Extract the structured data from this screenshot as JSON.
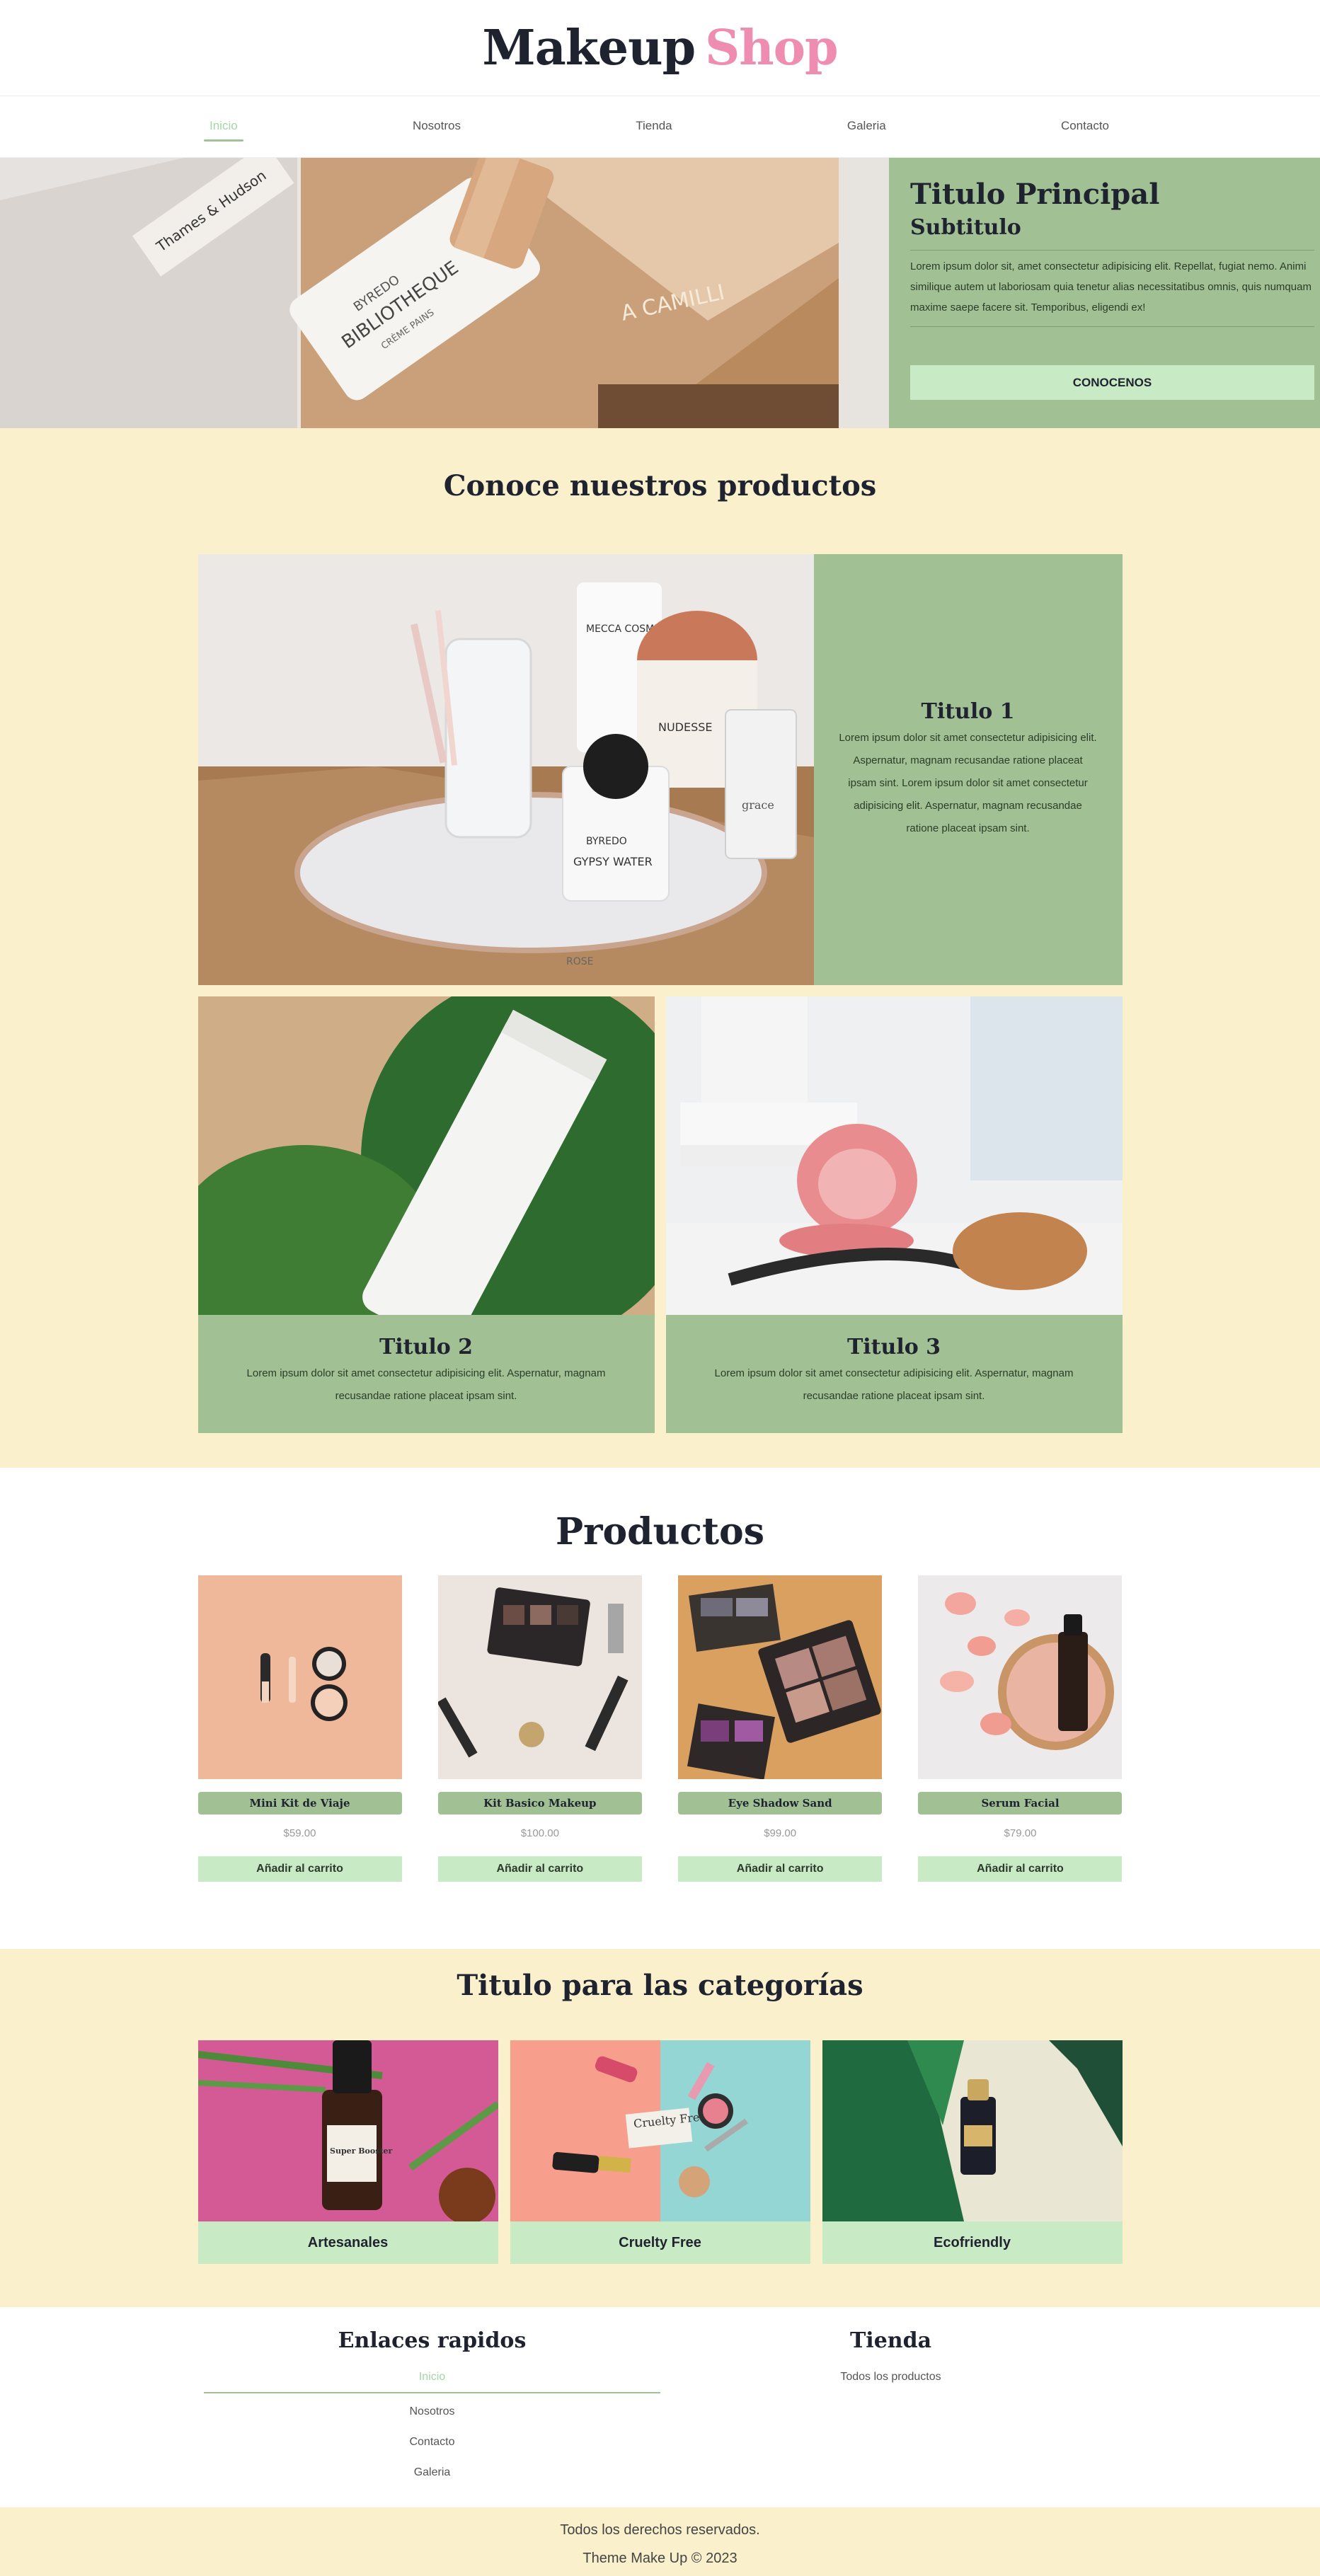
{
  "header": {
    "logo_main": "Makeup",
    "logo_accent": "Shop"
  },
  "nav": {
    "items": [
      "Inicio",
      "Nosotros",
      "Tienda",
      "Galeria",
      "Contacto"
    ]
  },
  "hero": {
    "title": "Titulo Principal",
    "subtitle": "Subtitulo",
    "text": "Lorem ipsum dolor sit, amet consectetur adipisicing elit. Repellat, fugiat nemo. Animi similique autem ut laboriosam quia tenetur alias necessitatibus omnis, quis numquam maxime saepe facere sit. Temporibus, eligendi ex!",
    "button": "CONOCENOS",
    "image_text": [
      "Thames & Hudson",
      "BYREDO",
      "BIBLIOTHEQUE",
      "CRÈME PAINS",
      "A CAMILLI"
    ]
  },
  "intro": {
    "title": "Conoce nuestros productos",
    "feature1": {
      "title": "Titulo 1",
      "text": "Lorem ipsum dolor sit amet consectetur adipisicing elit. Aspernatur, magnam recusandae ratione placeat ipsam sint. Lorem ipsum dolor sit amet consectetur adipisicing elit. Aspernatur, magnam recusandae ratione placeat ipsam sint.",
      "image_text": [
        "MECCA COSMETICA",
        "NUDESSE",
        "BYREDO",
        "GYPSY WATER",
        "grace",
        "ROSE"
      ]
    },
    "feature2": {
      "title": "Titulo 2",
      "text": "Lorem ipsum dolor sit amet consectetur adipisicing elit. Aspernatur, magnam recusandae ratione placeat ipsam sint."
    },
    "feature3": {
      "title": "Titulo 3",
      "text": "Lorem ipsum dolor sit amet consectetur adipisicing elit. Aspernatur, magnam recusandae ratione placeat ipsam sint."
    }
  },
  "productos": {
    "title": "Productos",
    "cart_label": "Añadir al carrito",
    "items": [
      {
        "name": "Mini Kit de Viaje",
        "price": "$59.00"
      },
      {
        "name": "Kit Basico Makeup",
        "price": "$100.00"
      },
      {
        "name": "Eye Shadow Sand",
        "price": "$99.00"
      },
      {
        "name": "Serum Facial",
        "price": "$79.00"
      }
    ]
  },
  "categorias": {
    "title": "Titulo para las categorías",
    "items": [
      {
        "label": "Artesanales",
        "image_text": [
          "Super Booster"
        ]
      },
      {
        "label": "Cruelty Free",
        "image_text": [
          "Cruelty Free"
        ]
      },
      {
        "label": "Ecofriendly"
      }
    ]
  },
  "footer": {
    "links_title": "Enlaces rapidos",
    "links": [
      "Inicio",
      "Nosotros",
      "Contacto",
      "Galeria"
    ],
    "shop_title": "Tienda",
    "shop_links": [
      "Todos los productos"
    ]
  },
  "bottom": {
    "rights": "Todos los derechos reservados.",
    "credit": "Theme Make Up © 2023"
  },
  "colors": {
    "green": "#a1c093",
    "light_green": "#c8ebc5",
    "cream": "#faf0cc",
    "pink": "#ef8db0",
    "dark": "#1f2330"
  }
}
